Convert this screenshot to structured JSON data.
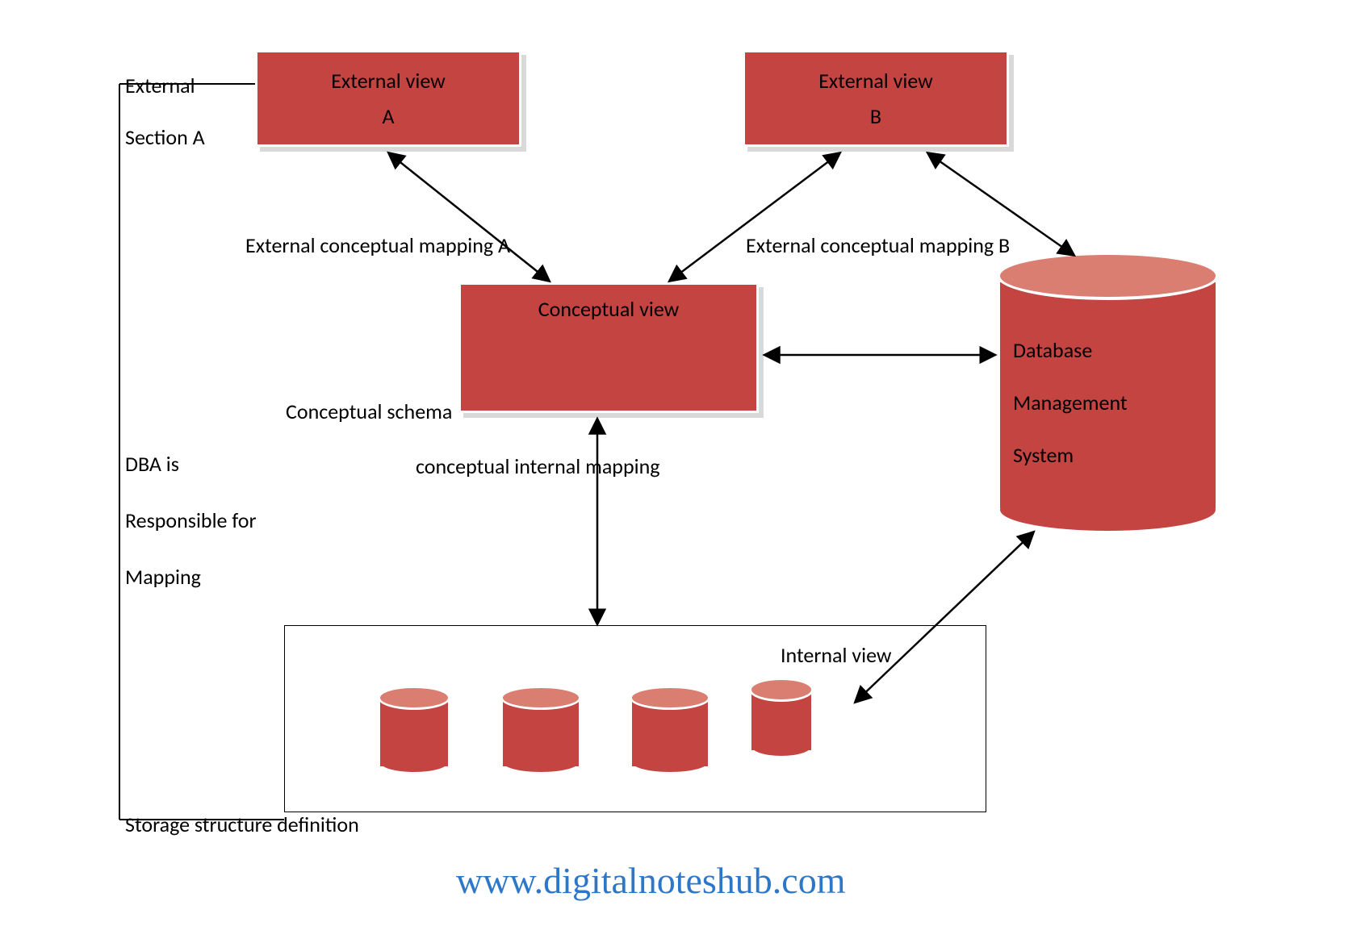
{
  "labels": {
    "external": "External",
    "section_a": "Section A",
    "dba_line1": "DBA is",
    "dba_line2": "Responsible for",
    "dba_line3": "Mapping",
    "storage_def": "Storage structure definition",
    "ext_map_a": "External conceptual mapping A",
    "ext_map_b": "External conceptual mapping B",
    "conceptual_schema": "Conceptual schema",
    "conc_int_map": "conceptual internal mapping",
    "internal_view": "Internal view"
  },
  "boxes": {
    "ext_a_title": "External view",
    "ext_a_sub": "A",
    "ext_b_title": "External view",
    "ext_b_sub": "B",
    "conceptual_title": "Conceptual view"
  },
  "dbms": {
    "line1": "Database",
    "line2": "Management",
    "line3": "System"
  },
  "watermark": "www.digitalnoteshub.com",
  "colors": {
    "box_fill": "#c44441",
    "box_top": "#d97e71",
    "watermark": "#2d77c8"
  }
}
